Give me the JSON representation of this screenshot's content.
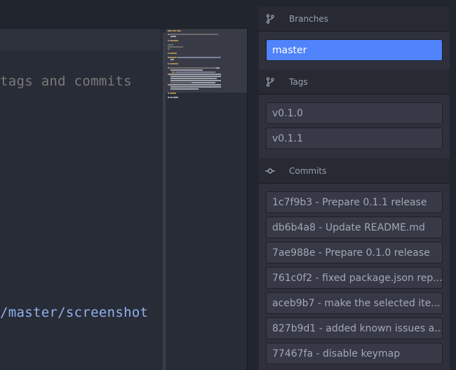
{
  "editor": {
    "comment_line": "tags and commits",
    "link_line": "/master/screenshot"
  },
  "sidebar": {
    "branches": {
      "title": "Branches",
      "icon": "git-branch-icon",
      "items": [
        {
          "label": "master",
          "selected": true
        }
      ]
    },
    "tags": {
      "title": "Tags",
      "icon": "git-branch-icon",
      "items": [
        {
          "label": "v0.1.0"
        },
        {
          "label": "v0.1.1"
        }
      ]
    },
    "commits": {
      "title": "Commits",
      "icon": "git-commit-icon",
      "items": [
        {
          "label": "1c7f9b3 - Prepare 0.1.1 release"
        },
        {
          "label": "db6b4a8 - Update README.md"
        },
        {
          "label": "7ae988e - Prepare 0.1.0 release"
        },
        {
          "label": "761c0f2 - fixed package.json rep..."
        },
        {
          "label": "aceb9b7 - make the selected ite..."
        },
        {
          "label": "827b9d1 - added known issues a..."
        },
        {
          "label": "77467fa - disable keymap"
        }
      ]
    }
  },
  "colors": {
    "accent": "#5083fc",
    "background": "#21252d",
    "editor_bg": "#282c36",
    "panel_bg": "#2e313b",
    "item_bg": "#373a46",
    "text": "#a3a8b3",
    "comment": "#7a7a7a",
    "link": "#8fb1ee"
  }
}
